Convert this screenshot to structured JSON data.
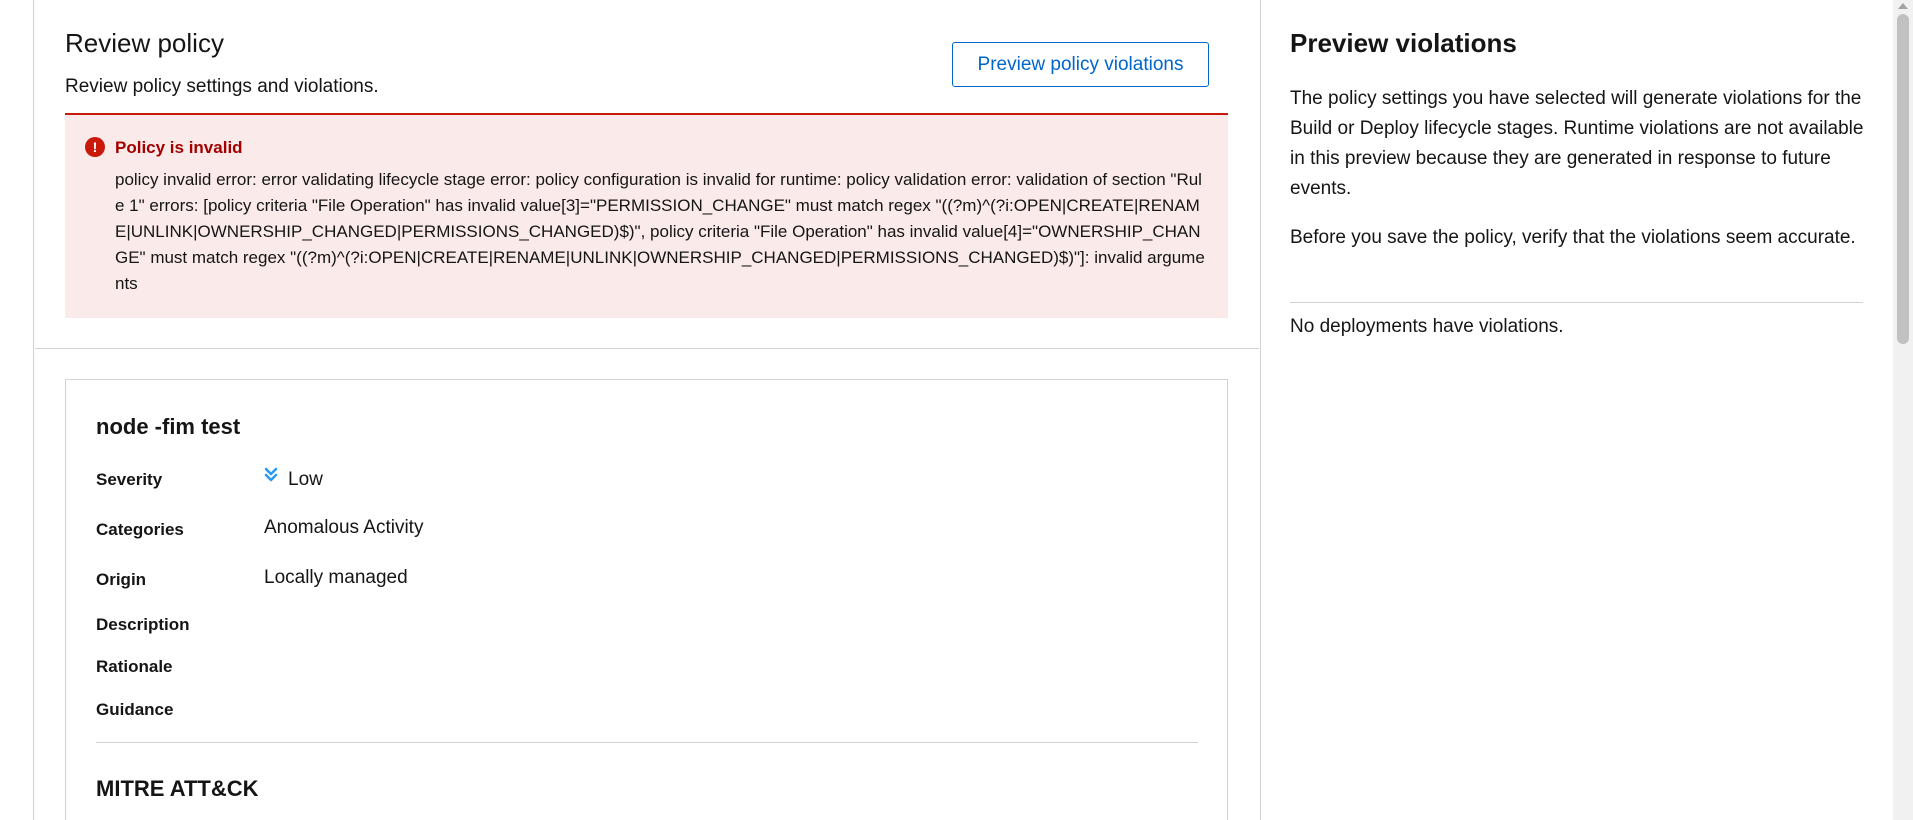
{
  "review": {
    "title": "Review policy",
    "subtitle": "Review policy settings and violations.",
    "preview_button": "Preview policy violations"
  },
  "alert": {
    "icon": "exclamation-circle-icon",
    "title": "Policy is invalid",
    "message": "policy invalid error: error validating lifecycle stage error: policy configuration is invalid for runtime: policy validation error: validation of section \"Rule 1\" errors: [policy criteria \"File Operation\" has invalid value[3]=\"PERMISSION_CHANGE\" must match regex \"((?m)^(?i:OPEN|CREATE|RENAME|UNLINK|OWNERSHIP_CHANGED|PERMISSIONS_CHANGED)$)\", policy criteria \"File Operation\" has invalid value[4]=\"OWNERSHIP_CHANGE\" must match regex \"((?m)^(?i:OPEN|CREATE|RENAME|UNLINK|OWNERSHIP_CHANGED|PERMISSIONS_CHANGED)$)\"]: invalid arguments",
    "color": "#c9190b"
  },
  "policy": {
    "name": "node -fim test",
    "severity_label": "Severity",
    "severity_value": "Low",
    "severity_icon": "angle-double-down-icon",
    "categories_label": "Categories",
    "categories_value": "Anomalous Activity",
    "origin_label": "Origin",
    "origin_value": "Locally managed",
    "description_label": "Description",
    "rationale_label": "Rationale",
    "guidance_label": "Guidance",
    "mitre_title": "MITRE ATT&CK"
  },
  "preview": {
    "title": "Preview violations",
    "paragraph1": "The policy settings you have selected will generate violations for the Build or Deploy lifecycle stages. Runtime violations are not available in this preview because they are generated in response to future events.",
    "paragraph2": "Before you save the policy, verify that the violations seem accurate.",
    "empty_message": "No deployments have violations."
  },
  "colors": {
    "primary": "#0066cc",
    "danger": "#c9190b",
    "danger_bg": "#faeaea",
    "severity_low": "#2b9af3"
  }
}
